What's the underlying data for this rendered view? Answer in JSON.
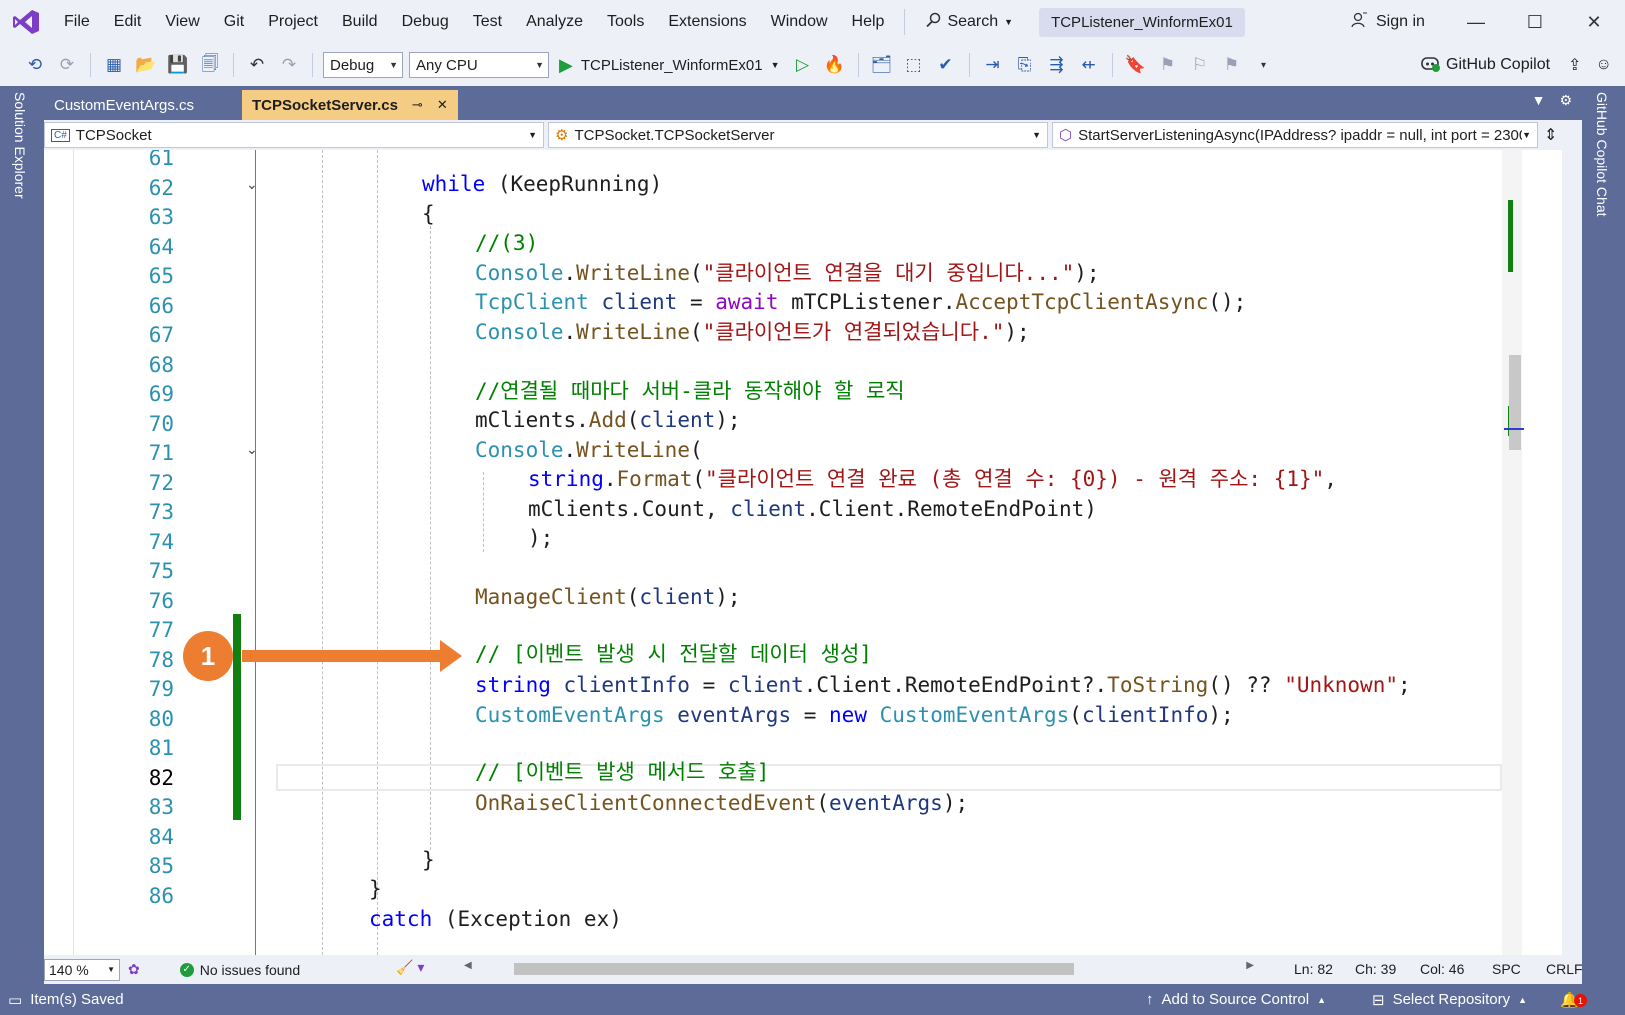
{
  "menu": {
    "items": [
      "File",
      "Edit",
      "View",
      "Git",
      "Project",
      "Build",
      "Debug",
      "Test",
      "Analyze",
      "Tools",
      "Extensions",
      "Window",
      "Help"
    ],
    "search_label": "Search",
    "solution_title": "TCPListener_WinformEx01",
    "sign_in": "Sign in"
  },
  "toolbar": {
    "config": "Debug",
    "platform": "Any CPU",
    "run_target": "TCPListener_WinformEx01",
    "copilot": "GitHub Copilot"
  },
  "side": {
    "left": "Solution Explorer",
    "right": "GitHub Copilot Chat"
  },
  "tabs": [
    {
      "label": "CustomEventArgs.cs",
      "active": false
    },
    {
      "label": "TCPSocketServer.cs",
      "active": true
    }
  ],
  "nav": {
    "project": "TCPSocket",
    "class": "TCPSocket.TCPSocketServer",
    "member": "StartServerListeningAsync(IPAddress? ipaddr = null, int port = 2300("
  },
  "line_numbers": [
    "61",
    "62",
    "63",
    "64",
    "65",
    "66",
    "67",
    "68",
    "69",
    "70",
    "71",
    "72",
    "73",
    "74",
    "75",
    "76",
    "77",
    "78",
    "79",
    "80",
    "81",
    "82",
    "83",
    "84",
    "85",
    "86"
  ],
  "current_line": "82",
  "code": {
    "l62_kw": "while",
    "l62_rest": " (KeepRunning)",
    "l63": "{",
    "l64": "//(3)",
    "l65_type": "Console",
    "l65_dot": ".",
    "l65_method": "WriteLine",
    "l65_open": "(",
    "l65_str": "\"클라이언트 연결을 대기 중입니다...\"",
    "l65_close": ");",
    "l66_type": "TcpClient",
    "l66_var": " client",
    "l66_eq": " = ",
    "l66_kw": "await",
    "l66_obj": " mTCPListener.",
    "l66_method": "AcceptTcpClientAsync",
    "l66_end": "();",
    "l67_type": "Console",
    "l67_dot": ".",
    "l67_method": "WriteLine",
    "l67_open": "(",
    "l67_str": "\"클라이언트가 연결되었습니다.\"",
    "l67_close": ");",
    "l69": "//연결될 때마다 서버-클라 동작해야 할 로직",
    "l70_obj": "mClients.",
    "l70_method": "Add",
    "l70_open": "(",
    "l70_var": "client",
    "l70_close": ");",
    "l71_type": "Console",
    "l71_dot": ".",
    "l71_method": "WriteLine",
    "l71_open": "(",
    "l72_kw": "string",
    "l72_dot": ".",
    "l72_method": "Format",
    "l72_open": "(",
    "l72_str": "\"클라이언트 연결 완료 (총 연결 수: {0}) - 원격 주소: {1}\"",
    "l72_comma": ",",
    "l73_a": "mClients.Count, ",
    "l73_var": "client",
    "l73_b": ".Client.RemoteEndPoint)",
    "l74": ");",
    "l76_method": "ManageClient",
    "l76_open": "(",
    "l76_var": "client",
    "l76_close": ");",
    "l78": "// [이벤트 발생 시 전달할 데이터 생성]",
    "l79_kw": "string",
    "l79_var": " clientInfo",
    "l79_eq": " = ",
    "l79_var2": "client",
    "l79_mid": ".Client.RemoteEndPoint?.",
    "l79_method": "ToString",
    "l79_op": "() ?? ",
    "l79_str": "\"Unknown\"",
    "l79_end": ";",
    "l80_type": "CustomEventArgs",
    "l80_var": " eventArgs",
    "l80_eq": " = ",
    "l80_kw": "new",
    "l80_sp": " ",
    "l80_type2": "CustomEventArgs",
    "l80_open": "(",
    "l80_var2": "clientInfo",
    "l80_close": ");",
    "l82": "// [이벤트 발생 메서드 호출]",
    "l83_method": "OnRaiseClientConnectedEvent",
    "l83_open": "(",
    "l83_var": "eventArgs",
    "l83_close": ");",
    "l85": "}",
    "l86": "}",
    "l87_kw": "catch",
    "l87_rest": " (Exception ex)"
  },
  "annotation": {
    "label": "1",
    "color": "#ed7d31"
  },
  "infobar": {
    "zoom": "140 %",
    "issues": "No issues found",
    "ln": "Ln: 82",
    "ch": "Ch: 39",
    "col": "Col: 46",
    "spc": "SPC",
    "eol": "CRLF"
  },
  "status": {
    "left": "Item(s) Saved",
    "source_control": "Add to Source Control",
    "repository": "Select Repository",
    "notifications": "1"
  },
  "colors": {
    "accent": "#5d6b98",
    "active_tab": "#f5cc84",
    "change_bar": "#108010"
  }
}
